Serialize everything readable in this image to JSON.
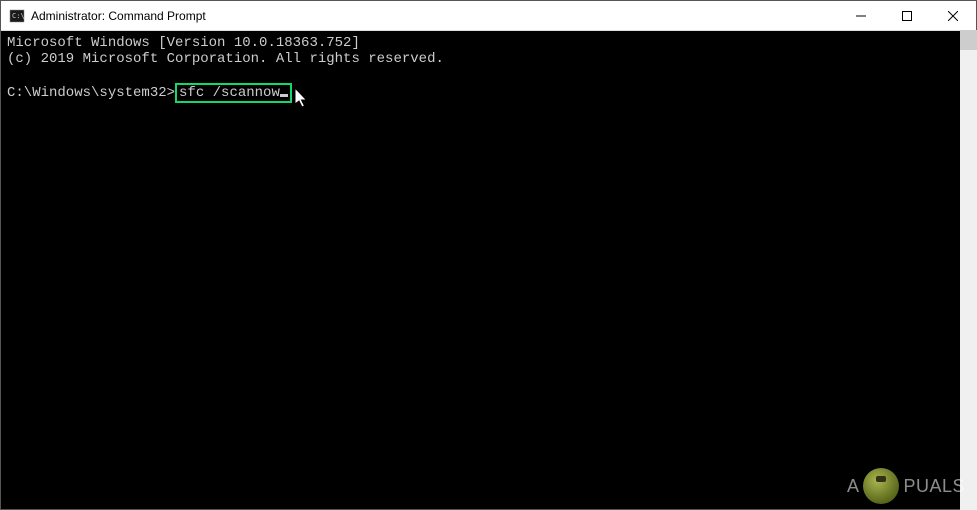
{
  "titlebar": {
    "title": "Administrator: Command Prompt"
  },
  "terminal": {
    "line1": "Microsoft Windows [Version 10.0.18363.752]",
    "line2": "(c) 2019 Microsoft Corporation. All rights reserved.",
    "prompt": "C:\\Windows\\system32>",
    "command": "sfc /scannow"
  },
  "watermark": {
    "text_before": "A",
    "text_after": "PUALS"
  }
}
